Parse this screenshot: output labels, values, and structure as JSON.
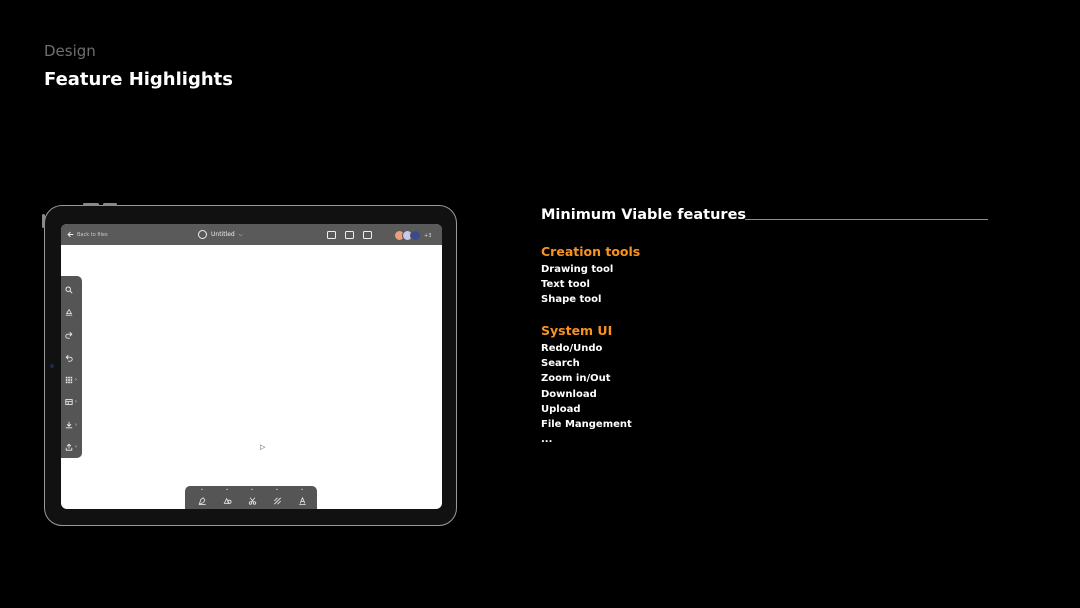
{
  "header": {
    "section_label": "Design",
    "title": "Feature Highlights"
  },
  "device": {
    "app": {
      "back_label": "Back to files",
      "doc_title": "Untitled",
      "collaborator_count": "+3",
      "top_icons": [
        "sticky-note-icon",
        "comment-icon",
        "present-icon"
      ],
      "left_tools": [
        "search-icon",
        "eraser-icon",
        "redo-icon",
        "undo-icon",
        "grid-icon",
        "layout-icon",
        "download-icon",
        "upload-icon"
      ],
      "bottom_tools": [
        "pen-tool-icon",
        "shapes-tool-icon",
        "scissors-tool-icon",
        "pattern-tool-icon",
        "text-tool-icon"
      ],
      "colors": {
        "bar": "#5a5a5a",
        "canvas": "#ffffff"
      }
    }
  },
  "features": {
    "title": "Minimum Viable features",
    "groups": [
      {
        "name": "Creation tools",
        "items": [
          "Drawing tool",
          "Text tool",
          "Shape tool"
        ]
      },
      {
        "name": "System UI",
        "items": [
          "Redo/Undo",
          "Search",
          "Zoom in/Out",
          "Download",
          "Upload",
          "File Mangement",
          "..."
        ]
      }
    ],
    "accent_color": "#f7931e"
  }
}
